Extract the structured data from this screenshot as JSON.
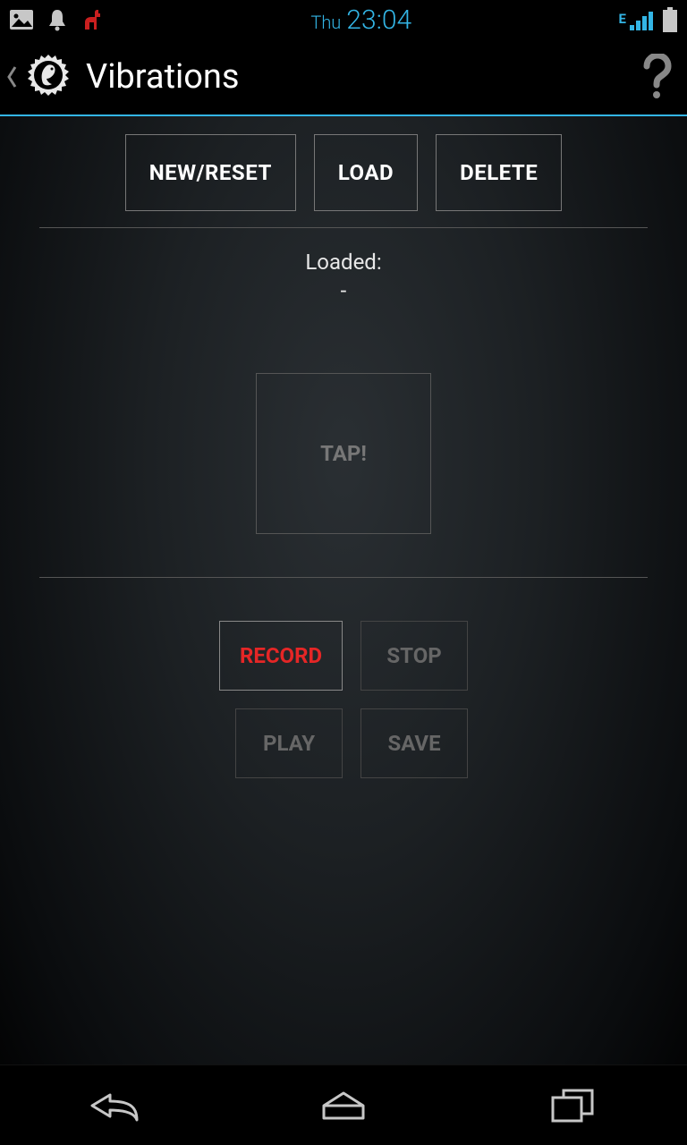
{
  "status": {
    "day": "Thu",
    "time": "23:04",
    "network_label": "E"
  },
  "actionbar": {
    "title": "Vibrations"
  },
  "buttons": {
    "new_reset": "NEW/RESET",
    "load": "LOAD",
    "delete": "DELETE",
    "record": "RECORD",
    "stop": "STOP",
    "play": "PLAY",
    "save": "SAVE"
  },
  "loaded": {
    "label": "Loaded:",
    "value": "-"
  },
  "tap": {
    "label": "TAP!"
  }
}
